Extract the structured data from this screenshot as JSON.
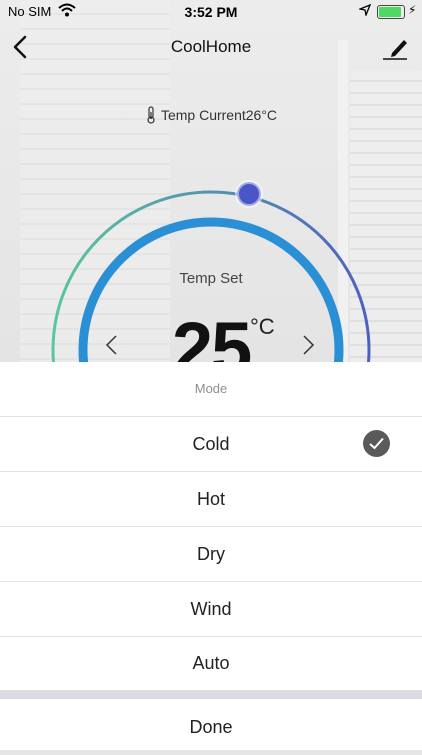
{
  "status_bar": {
    "carrier": "No SIM",
    "time": "3:52 PM",
    "battery_level": 1.0
  },
  "nav": {
    "title": "CoolHome",
    "back_icon": "chevron-left-icon",
    "edit_icon": "pencil-icon"
  },
  "current_temp": {
    "label": "Temp Current26°C",
    "icon": "thermometer-icon"
  },
  "dial": {
    "label": "Temp Set",
    "value": "25",
    "unit": "°C"
  },
  "mode_sheet": {
    "title": "Mode",
    "options": [
      {
        "label": "Cold",
        "selected": true
      },
      {
        "label": "Hot",
        "selected": false
      },
      {
        "label": "Dry",
        "selected": false
      },
      {
        "label": "Wind",
        "selected": false
      },
      {
        "label": "Auto",
        "selected": false
      }
    ],
    "done_label": "Done"
  },
  "colors": {
    "ring_start": "#5bc5a0",
    "ring_end": "#4f5fc0",
    "inner_ring": "#2b8fd6",
    "knob": "#4a55c8",
    "battery": "#4cd964",
    "check": "#5a5a5a"
  }
}
